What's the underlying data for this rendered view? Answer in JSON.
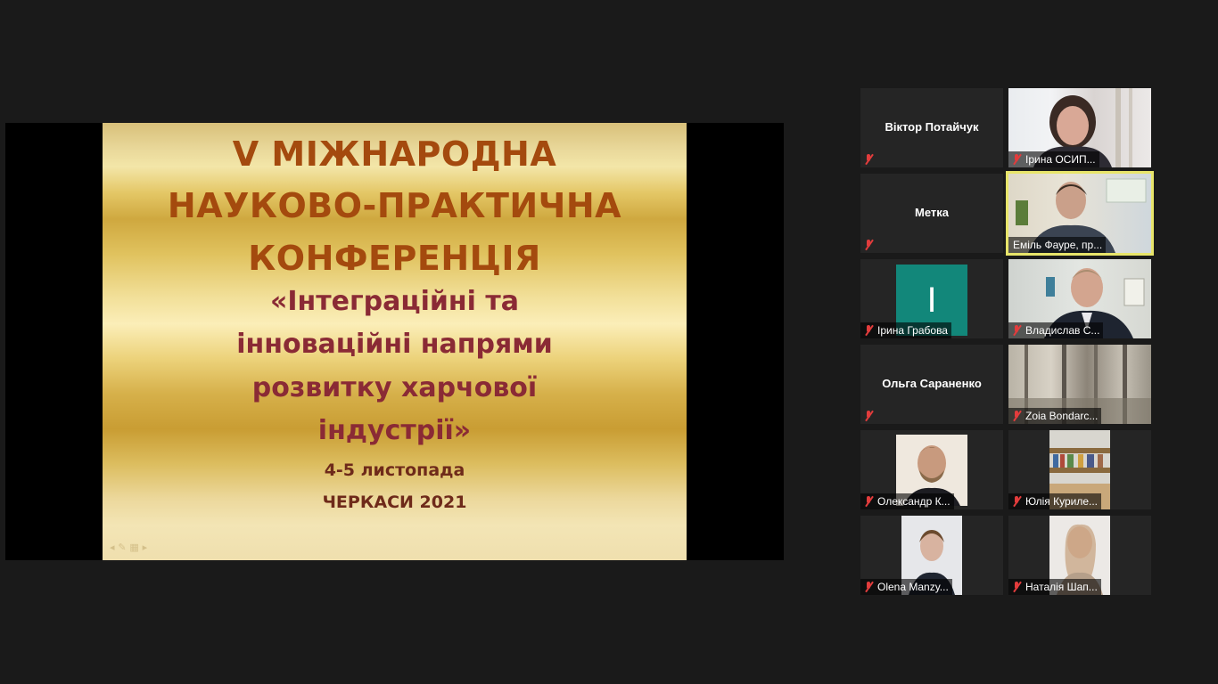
{
  "slide": {
    "line1": "V МІЖНАРОДНА",
    "line2": "НАУКОВО-ПРАКТИЧНА",
    "line3": "КОНФЕРЕНЦІЯ",
    "sub1": "«Інтеграційні та",
    "sub2": "інноваційні напрями",
    "sub3": "розвитку харчової",
    "sub4": "індустрії»",
    "date": "4-5 листопада",
    "place": "ЧЕРКАСИ 2021"
  },
  "participants": [
    {
      "name": "Віктор Потайчук",
      "video": false
    },
    {
      "name": "Ірина ОСИП...",
      "video": true
    },
    {
      "name": "Метка",
      "video": false
    },
    {
      "name": "Еміль Фауре, пр...",
      "video": true
    },
    {
      "name": "Ірина Грабова",
      "avatar": "I"
    },
    {
      "name": "Владислав С...",
      "video": true
    },
    {
      "name": "Ольга Сараненко",
      "video": false
    },
    {
      "name": "Zoia Bondarc...",
      "video": true
    },
    {
      "name": "Олександр К...",
      "video": true
    },
    {
      "name": "Юлія Куриле...",
      "video": true
    },
    {
      "name": "Olena Manzy...",
      "video": true
    },
    {
      "name": "Наталія Шап...",
      "video": true
    }
  ],
  "colors": {
    "speaker_outline": "#e8e56a",
    "muted": "#e23c3c",
    "avatar": "#12877a"
  }
}
